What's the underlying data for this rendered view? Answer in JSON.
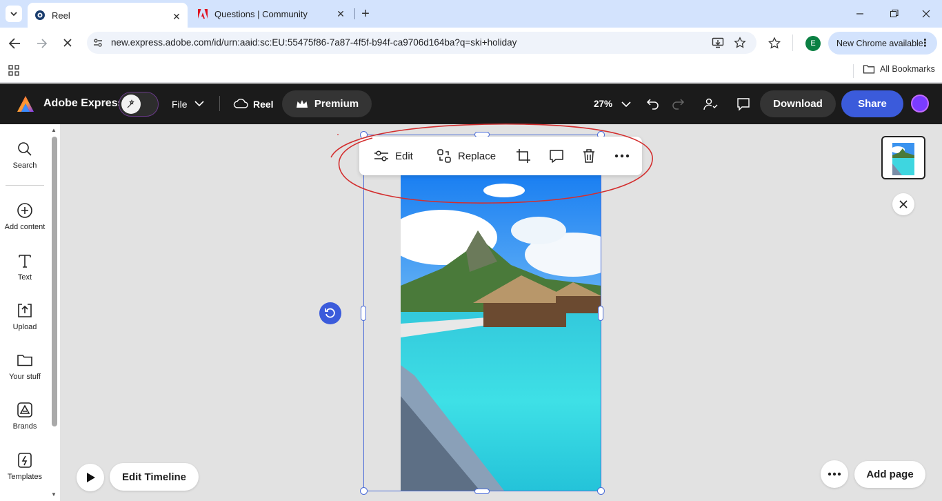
{
  "browser": {
    "tabs": [
      {
        "title": "Reel",
        "active": true
      },
      {
        "title": "Questions | Community",
        "active": false
      }
    ],
    "url": "new.express.adobe.com/id/urn:aaid:sc:EU:55475f86-7a87-4f5f-b94f-ca9706d164ba?q=ski+holiday",
    "profile_initial": "E",
    "new_chrome_label": "New Chrome available",
    "bookmarks_label": "All Bookmarks"
  },
  "app": {
    "brand": "Adobe Express",
    "file_label": "File",
    "doc_name": "Reel",
    "premium_label": "Premium",
    "zoom": "27%",
    "download_label": "Download",
    "share_label": "Share",
    "colors": {
      "accent": "#3b5bdb",
      "header_bg": "#1b1b1b",
      "selection": "#4a6bd8",
      "annotation": "#d32f2f"
    }
  },
  "sidebar": {
    "items": [
      {
        "label": "Search",
        "icon": "search-icon"
      },
      {
        "label": "Add content",
        "icon": "plus-circle-icon"
      },
      {
        "label": "Text",
        "icon": "text-icon"
      },
      {
        "label": "Upload",
        "icon": "upload-icon"
      },
      {
        "label": "Your stuff",
        "icon": "folder-icon"
      },
      {
        "label": "Brands",
        "icon": "brands-icon"
      },
      {
        "label": "Templates",
        "icon": "templates-icon"
      }
    ]
  },
  "context_toolbar": {
    "edit_label": "Edit",
    "replace_label": "Replace"
  },
  "bottom": {
    "edit_timeline_label": "Edit Timeline",
    "add_page_label": "Add page"
  }
}
